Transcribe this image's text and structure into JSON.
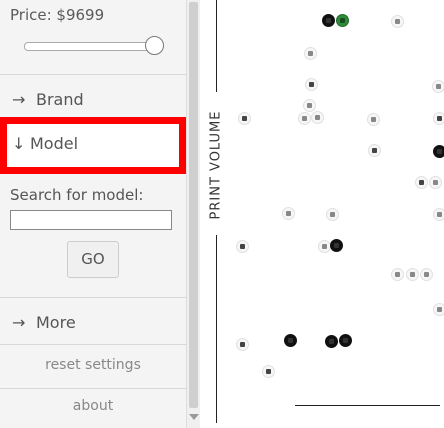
{
  "sidebar": {
    "price_label": "Price: $9699",
    "slider": {
      "value_fraction": 1.0
    },
    "nav": {
      "brand": {
        "arrow": "→",
        "label": "Brand"
      },
      "model": {
        "arrow": "↓",
        "label": "Model"
      },
      "more": {
        "arrow": "→",
        "label": "More"
      }
    },
    "search": {
      "label": "Search for model:",
      "value": "",
      "placeholder": ""
    },
    "go_label": "GO",
    "reset_label": "reset settings",
    "about_label": "about"
  },
  "plot": {
    "axis_label": "PRINT VOLUME"
  },
  "colors": {
    "highlight": "#ff0000",
    "sidebar_bg": "#f4f4f4"
  }
}
